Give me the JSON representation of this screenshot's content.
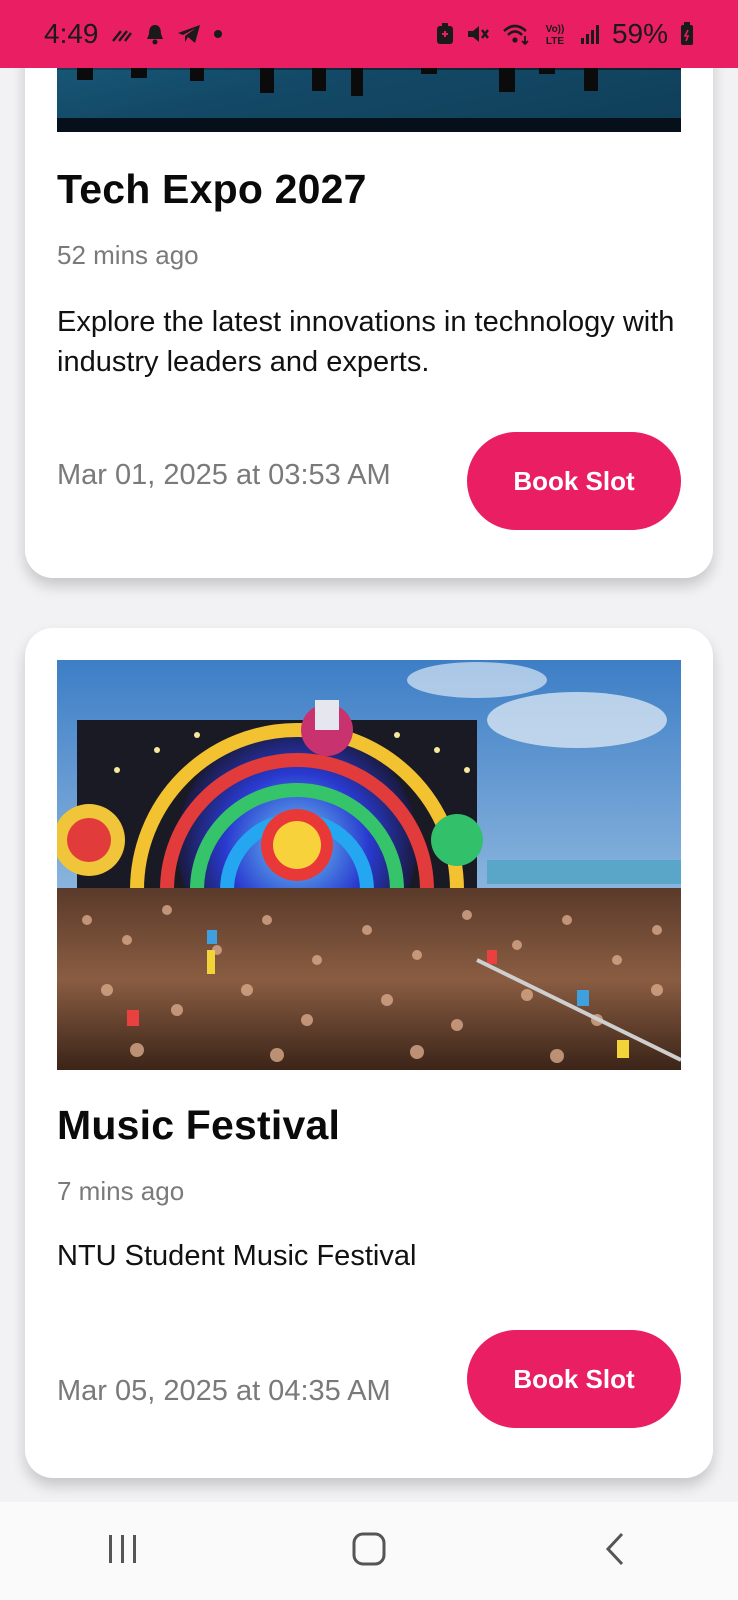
{
  "status_bar": {
    "time": "4:49",
    "battery": "59%",
    "network": "LTE",
    "left_icons": [
      "signal-waves-icon",
      "bell-icon",
      "telegram-icon",
      "dot-icon"
    ],
    "right_icons": [
      "battery-saver-icon",
      "mute-icon",
      "wifi-icon",
      "volte-icon",
      "cell-signal-icon",
      "battery-icon"
    ]
  },
  "theme": {
    "accent": "#e91e63",
    "muted_text": "#7a7a7a",
    "card_bg": "#ffffff"
  },
  "events": [
    {
      "title": "Tech Expo 2027",
      "posted": "52 mins ago",
      "description": "Explore the latest innovations in technology with industry leaders and experts.",
      "date": "Mar 01, 2025 at 03:53 AM",
      "button": "Book Slot",
      "image_icon": "expo-hall-photo"
    },
    {
      "title": "Music Festival",
      "posted": "7 mins ago",
      "description": "NTU Student Music Festival",
      "date": "Mar 05, 2025 at 04:35 AM",
      "button": "Book Slot",
      "image_icon": "festival-stage-photo"
    }
  ],
  "nav_bar": {
    "recents": "recent-apps-icon",
    "home": "home-icon",
    "back": "back-icon"
  }
}
